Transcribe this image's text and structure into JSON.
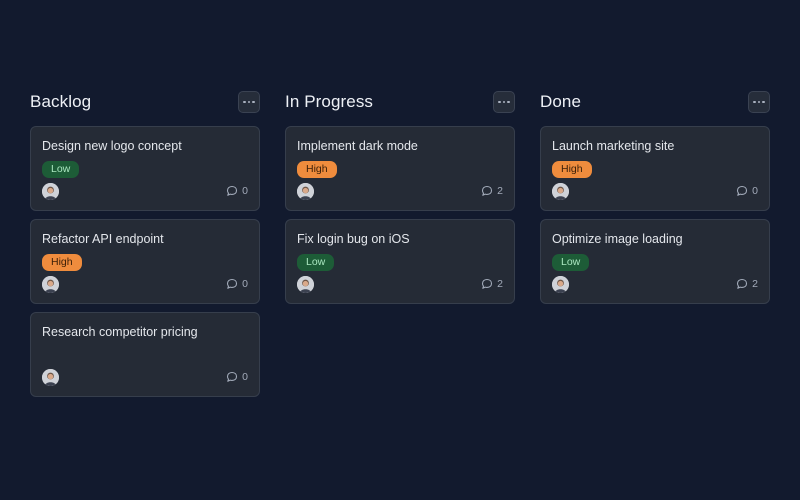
{
  "board": {
    "columns": [
      {
        "title": "Backlog",
        "cards": [
          {
            "title": "Design new logo concept",
            "priority": "Low",
            "comments": "0"
          },
          {
            "title": "Refactor API endpoint",
            "priority": "High",
            "comments": "0"
          },
          {
            "title": "Research competitor pricing",
            "priority": "",
            "comments": "0"
          }
        ]
      },
      {
        "title": "In Progress",
        "cards": [
          {
            "title": "Implement dark mode",
            "priority": "High",
            "comments": "2"
          },
          {
            "title": "Fix login bug on iOS",
            "priority": "Low",
            "comments": "2"
          }
        ]
      },
      {
        "title": "Done",
        "cards": [
          {
            "title": "Launch marketing site",
            "priority": "High",
            "comments": "0"
          },
          {
            "title": "Optimize image loading",
            "priority": "Low",
            "comments": "2"
          }
        ]
      }
    ]
  },
  "icons": {
    "column_menu": "more-horizontal-icon",
    "comment": "comment-bubble-icon",
    "avatar": "user-avatar"
  },
  "colors": {
    "background": "#121a2e",
    "card": "#252b36",
    "priority_low": "#1d5c37",
    "priority_high": "#ef8c3d"
  }
}
